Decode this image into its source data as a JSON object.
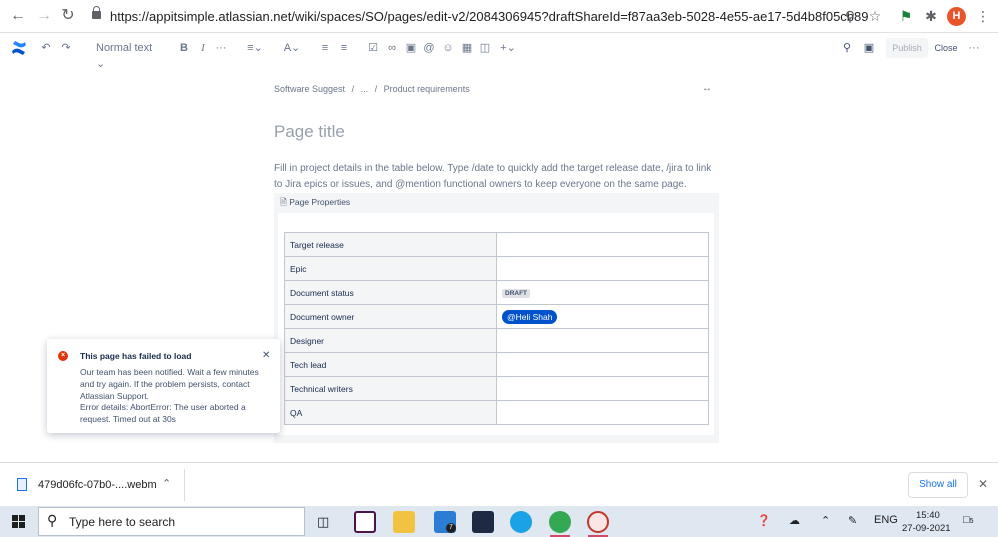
{
  "browser": {
    "url": "https://appitsimple.atlassian.net/wiki/spaces/SO/pages/edit-v2/2084306945?draftShareId=f87aa3eb-5028-4e55-ae17-5d4b8f05cb89",
    "avatar_letter": "H"
  },
  "toolbar": {
    "text_style": "Normal text",
    "publish_label": "Publish",
    "close_label": "Close"
  },
  "page": {
    "breadcrumb": [
      "Software Suggest",
      "/",
      "...",
      "/",
      "Product requirements"
    ],
    "title_placeholder": "Page title",
    "intro": "Fill in project details in the table below. Type /date to quickly add the target release date, /jira to link to Jira epics or issues, and @mention functional owners to keep everyone on the same page.",
    "macro_title": "Page Properties",
    "rows": [
      {
        "key": "Target release",
        "value": ""
      },
      {
        "key": "Epic",
        "value": ""
      },
      {
        "key": "Document status",
        "value": "DRAFT"
      },
      {
        "key": "Document owner",
        "value": "@Heli Shah"
      },
      {
        "key": "Designer",
        "value": ""
      },
      {
        "key": "Tech lead",
        "value": ""
      },
      {
        "key": "Technical writers",
        "value": ""
      },
      {
        "key": "QA",
        "value": ""
      }
    ]
  },
  "toast": {
    "title": "This page has failed to load",
    "message": "Our team has been notified. Wait a few minutes and try again. If the problem persists, contact Atlassian Support.",
    "details": "Error details: AbortError: The user aborted a request. Timed out at 30s"
  },
  "download": {
    "filename": "479d06fc-07b0-....webm",
    "show_all": "Show all"
  },
  "taskbar": {
    "search_placeholder": "Type here to search",
    "badge_count": "7",
    "language": "ENG",
    "time": "15:40",
    "date": "27-09-2021",
    "notification_count": "5"
  },
  "colors": {
    "confluence_blue": "#0052cc",
    "error_red": "#de350b",
    "mention_bg": "#0052cc"
  }
}
